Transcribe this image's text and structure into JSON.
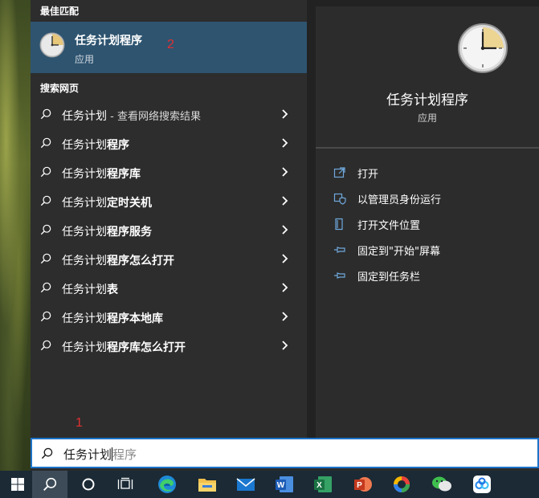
{
  "results": {
    "best_match_header": "最佳匹配",
    "best_match": {
      "name": "任务计划程序",
      "kind": "应用",
      "annotation": "2"
    },
    "web_header": "搜索网页",
    "web_items": [
      {
        "bold": "任务计划",
        "rest": "",
        "sub": " - 查看网络搜索结果"
      },
      {
        "bold": "任务计划",
        "rest": "程序",
        "sub": ""
      },
      {
        "bold": "任务计划",
        "rest": "程序库",
        "sub": ""
      },
      {
        "bold": "任务计划",
        "rest": "定时关机",
        "sub": ""
      },
      {
        "bold": "任务计划",
        "rest": "程序服务",
        "sub": ""
      },
      {
        "bold": "任务计划",
        "rest": "程序怎么打开",
        "sub": ""
      },
      {
        "bold": "任务计划",
        "rest": "表",
        "sub": ""
      },
      {
        "bold": "任务计划",
        "rest": "程序本地库",
        "sub": ""
      },
      {
        "bold": "任务计划",
        "rest": "程序库怎么打开",
        "sub": ""
      }
    ],
    "search_annotation": "1"
  },
  "detail": {
    "title": "任务计划程序",
    "kind": "应用",
    "actions": [
      {
        "label": "打开",
        "icon": "open-icon"
      },
      {
        "label": "以管理员身份运行",
        "icon": "shield-icon"
      },
      {
        "label": "打开文件位置",
        "icon": "file-location-icon"
      },
      {
        "label": "固定到\"开始\"屏幕",
        "icon": "pin-icon"
      },
      {
        "label": "固定到任务栏",
        "icon": "pin-icon"
      }
    ]
  },
  "search": {
    "typed": "任务计划",
    "completion": "程序"
  },
  "taskbar": {
    "items": [
      "windows-start-icon",
      "search-icon",
      "cortana-icon",
      "task-view-icon",
      "edge-icon",
      "file-explorer-icon",
      "mail-icon",
      "word-icon",
      "excel-icon",
      "powerpoint-icon",
      "photos-icon",
      "wechat-icon",
      "baidu-netdisk-icon"
    ]
  },
  "colors": {
    "selection": "#2e5470",
    "accent": "#1c73c9",
    "annotation": "#e13030"
  }
}
